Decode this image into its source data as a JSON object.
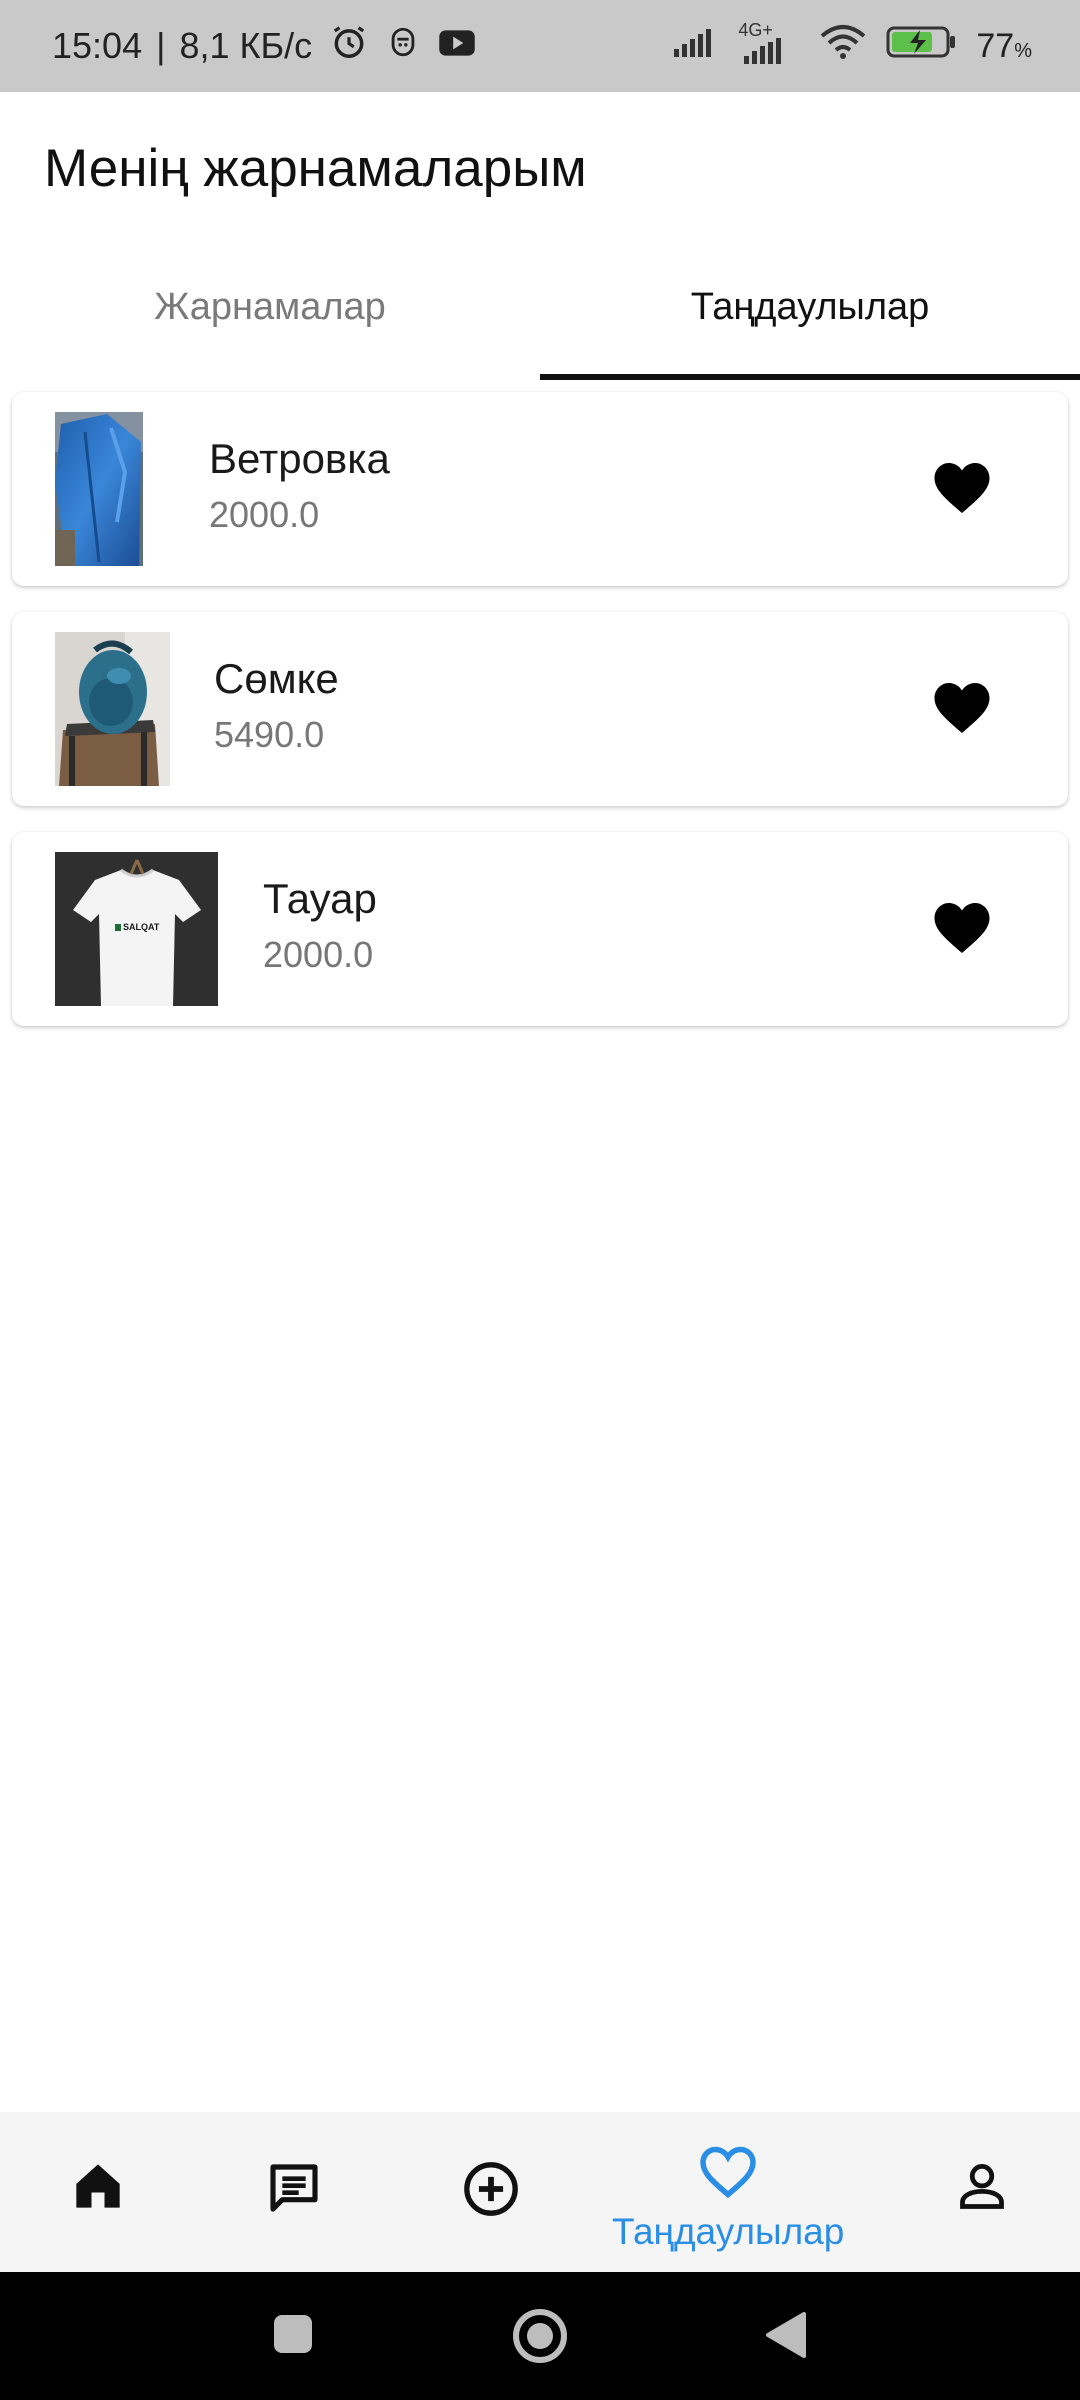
{
  "status_bar": {
    "time": "15:04",
    "separator": "|",
    "speed": "8,1 КБ/с",
    "network": "4G+",
    "battery_percent": "77",
    "battery_unit": "%",
    "battery_level": 0.77,
    "icons": [
      "alarm-icon",
      "face-icon",
      "youtube-icon",
      "signal-icon",
      "signal-4g-icon",
      "wifi-icon",
      "battery-charging-icon"
    ]
  },
  "header": {
    "title": "Менің жарнамаларым"
  },
  "tabs": [
    {
      "label": "Жарнамалар",
      "active": false
    },
    {
      "label": "Таңдаулылар",
      "active": true
    }
  ],
  "favorites": [
    {
      "name": "Ветровка",
      "price": "2000.0",
      "image": "blue-jacket-photo",
      "favorited": true
    },
    {
      "name": "Сөмке",
      "price": "5490.0",
      "image": "backpack-photo",
      "favorited": true
    },
    {
      "name": "Тауар",
      "price": "2000.0",
      "image": "white-tshirt-photo",
      "thumb_text": "SALQAT",
      "favorited": true
    }
  ],
  "bottom_nav": {
    "items": [
      {
        "icon": "home-icon",
        "label": "",
        "active": false
      },
      {
        "icon": "chat-icon",
        "label": "",
        "active": false
      },
      {
        "icon": "add-circle-icon",
        "label": "",
        "active": false
      },
      {
        "icon": "heart-outline-icon",
        "label": "Таңдаулылар",
        "active": true
      },
      {
        "icon": "person-icon",
        "label": "",
        "active": false
      }
    ],
    "active_color": "#2a8ee6"
  },
  "system_nav": {
    "icons": [
      "square-icon",
      "circle-icon",
      "back-triangle-icon"
    ]
  }
}
